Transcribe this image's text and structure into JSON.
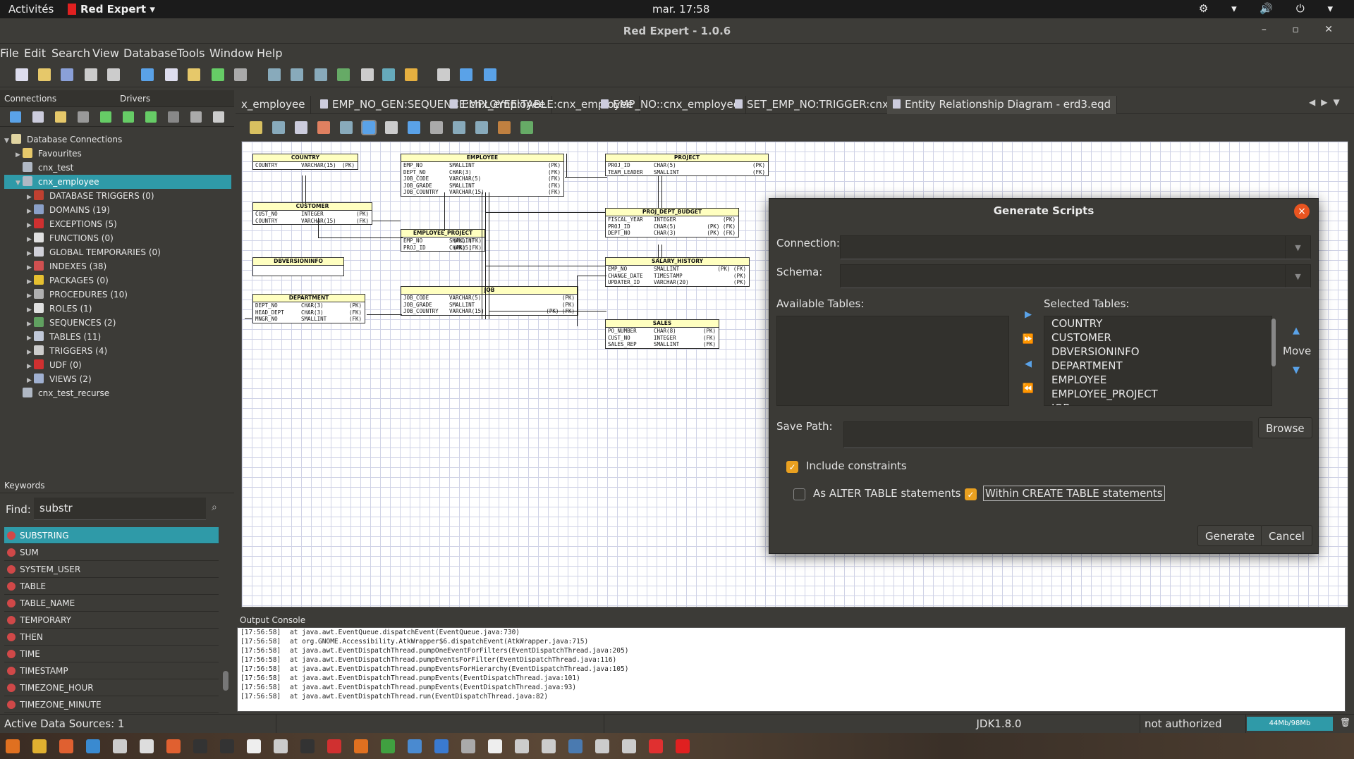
{
  "topbar": {
    "activities": "Activités",
    "app": "Red Expert",
    "clock": "mar. 17:58",
    "tray": "⚙ ▾ 🔊 ⏻ ▾"
  },
  "window": {
    "title": "Red Expert - 1.0.6",
    "controls": "–  ▫  ✕"
  },
  "menu": [
    "File",
    "Edit",
    "Search",
    "View",
    "Database",
    "Tools",
    "Window",
    "Help"
  ],
  "left": {
    "tab_connections": "Connections",
    "tab_drivers": "Drivers",
    "tree": [
      {
        "label": "Database Connections",
        "level": 0,
        "arrow": "▼",
        "color": "#e0d4a0"
      },
      {
        "label": "Favourites",
        "level": 1,
        "arrow": "▶",
        "color": "#e6c86a"
      },
      {
        "label": "cnx_test",
        "level": 1,
        "arrow": "",
        "color": "#b0b8c4"
      },
      {
        "label": "cnx_employee",
        "level": 1,
        "arrow": "▼",
        "color": "#b0b8c4",
        "selected": true
      },
      {
        "label": "DATABASE TRIGGERS (0)",
        "level": 2,
        "arrow": "▶",
        "color": "#c04030"
      },
      {
        "label": "DOMAINS (19)",
        "level": 2,
        "arrow": "▶",
        "color": "#8aa0c8"
      },
      {
        "label": "EXCEPTIONS (5)",
        "level": 2,
        "arrow": "▶",
        "color": "#d03030"
      },
      {
        "label": "FUNCTIONS (0)",
        "level": 2,
        "arrow": "▶",
        "color": "#e0e0e0"
      },
      {
        "label": "GLOBAL TEMPORARIES (0)",
        "level": 2,
        "arrow": "▶",
        "color": "#d0d0d8"
      },
      {
        "label": "INDEXES (38)",
        "level": 2,
        "arrow": "▶",
        "color": "#d05050"
      },
      {
        "label": "PACKAGES (0)",
        "level": 2,
        "arrow": "▶",
        "color": "#e6c030"
      },
      {
        "label": "PROCEDURES (10)",
        "level": 2,
        "arrow": "▶",
        "color": "#b0b0b0"
      },
      {
        "label": "ROLES (1)",
        "level": 2,
        "arrow": "▶",
        "color": "#e0e0e0"
      },
      {
        "label": "SEQUENCES (2)",
        "level": 2,
        "arrow": "▶",
        "color": "#60a060"
      },
      {
        "label": "TABLES (11)",
        "level": 2,
        "arrow": "▶",
        "color": "#c0c8d8"
      },
      {
        "label": "TRIGGERS (4)",
        "level": 2,
        "arrow": "▶",
        "color": "#cccccc"
      },
      {
        "label": "UDF (0)",
        "level": 2,
        "arrow": "▶",
        "color": "#d03030"
      },
      {
        "label": "VIEWS (2)",
        "level": 2,
        "arrow": "▶",
        "color": "#a0b0d0"
      },
      {
        "label": "cnx_test_recurse",
        "level": 1,
        "arrow": "",
        "color": "#b0b8c4"
      }
    ]
  },
  "keywords": {
    "title": "Keywords",
    "find_label": "Find:",
    "find_value": "substr",
    "items": [
      "SUBSTRING",
      "SUM",
      "SYSTEM_USER",
      "TABLE",
      "TABLE_NAME",
      "TEMPORARY",
      "THEN",
      "TIME",
      "TIMESTAMP",
      "TIMEZONE_HOUR",
      "TIMEZONE_MINUTE"
    ]
  },
  "tabs": [
    "x_employee",
    "EMP_NO_GEN:SEQUENCE:cnx_employee",
    "EMPLOYEE:TABLE:cnx_employee",
    "EMP_NO::cnx_employee",
    "SET_EMP_NO:TRIGGER:cnx_employee",
    "Entity Relationship Diagram - erd3.eqd"
  ],
  "erd": {
    "entities": [
      {
        "name": "COUNTRY",
        "rows": [
          [
            "COUNTRY",
            "VARCHAR(15)",
            "(PK)"
          ]
        ]
      },
      {
        "name": "EMPLOYEE",
        "rows": [
          [
            "EMP_NO",
            "SMALLINT",
            "(PK)"
          ],
          [
            "DEPT_NO",
            "CHAR(3)",
            "(FK)"
          ],
          [
            "JOB_CODE",
            "VARCHAR(5)",
            "(FK)"
          ],
          [
            "JOB_GRADE",
            "SMALLINT",
            "(FK)"
          ],
          [
            "JOB_COUNTRY",
            "VARCHAR(15)",
            "(FK)"
          ]
        ]
      },
      {
        "name": "PROJECT",
        "rows": [
          [
            "PROJ_ID",
            "CHAR(5)",
            "(PK)"
          ],
          [
            "TEAM_LEADER",
            "SMALLINT",
            "(FK)"
          ]
        ]
      },
      {
        "name": "CUSTOMER",
        "rows": [
          [
            "CUST_NO",
            "INTEGER",
            "(PK)"
          ],
          [
            "COUNTRY",
            "VARCHAR(15)",
            "(FK)"
          ]
        ]
      },
      {
        "name": "EMPLOYEE_PROJECT",
        "rows": [
          [
            "EMP_NO",
            "SMALLINT",
            "(PK) (FK)"
          ],
          [
            "PROJ_ID",
            "CHAR(5)",
            "(PK) (FK)"
          ]
        ]
      },
      {
        "name": "PROJ_DEPT_BUDGET",
        "rows": [
          [
            "FISCAL_YEAR",
            "INTEGER",
            "(PK)"
          ],
          [
            "PROJ_ID",
            "CHAR(5)",
            "(PK) (FK)"
          ],
          [
            "DEPT_NO",
            "CHAR(3)",
            "(PK) (FK)"
          ]
        ]
      },
      {
        "name": "DBVERSIONINFO",
        "rows": []
      },
      {
        "name": "SALARY_HISTORY",
        "rows": [
          [
            "EMP_NO",
            "SMALLINT",
            "(PK) (FK)"
          ],
          [
            "CHANGE_DATE",
            "TIMESTAMP",
            "(PK)"
          ],
          [
            "UPDATER_ID",
            "VARCHAR(20)",
            "(PK)"
          ]
        ]
      },
      {
        "name": "JOB",
        "rows": [
          [
            "JOB_CODE",
            "VARCHAR(5)",
            "(PK)"
          ],
          [
            "JOB_GRADE",
            "SMALLINT",
            "(PK)"
          ],
          [
            "JOB_COUNTRY",
            "VARCHAR(15)",
            "(PK) (FK)"
          ]
        ]
      },
      {
        "name": "DEPARTMENT",
        "rows": [
          [
            "DEPT_NO",
            "CHAR(3)",
            "(PK)"
          ],
          [
            "HEAD_DEPT",
            "CHAR(3)",
            "(FK)"
          ],
          [
            "MNGR_NO",
            "SMALLINT",
            "(FK)"
          ]
        ]
      },
      {
        "name": "SALES",
        "rows": [
          [
            "PO_NUMBER",
            "CHAR(8)",
            "(PK)"
          ],
          [
            "CUST_NO",
            "INTEGER",
            "(FK)"
          ],
          [
            "SALES_REP",
            "SMALLINT",
            "(FK)"
          ]
        ]
      }
    ]
  },
  "dialog": {
    "title": "Generate Scripts",
    "close": "×",
    "connection_label": "Connection:",
    "schema_label": "Schema:",
    "available_label": "Available Tables:",
    "selected_label": "Selected Tables:",
    "selected_tables": [
      "COUNTRY",
      "CUSTOMER",
      "DBVERSIONINFO",
      "DEPARTMENT",
      "EMPLOYEE",
      "EMPLOYEE_PROJECT",
      "JOB"
    ],
    "move_label": "Move",
    "save_path_label": "Save Path:",
    "browse": "Browse",
    "include_constraints": "Include constraints",
    "include_constraints_checked": true,
    "as_alter": "As ALTER TABLE statements",
    "as_alter_checked": false,
    "within_create": "Within CREATE TABLE statements",
    "within_create_checked": true,
    "generate": "Generate",
    "cancel": "Cancel"
  },
  "output": {
    "title": "Output Console",
    "lines": [
      [
        "[17:56:58]",
        "at java.awt.EventQueue.dispatchEvent(EventQueue.java:730)"
      ],
      [
        "[17:56:58]",
        "at org.GNOME.Accessibility.AtkWrapper$6.dispatchEvent(AtkWrapper.java:715)"
      ],
      [
        "[17:56:58]",
        "at java.awt.EventDispatchThread.pumpOneEventForFilters(EventDispatchThread.java:205)"
      ],
      [
        "[17:56:58]",
        "at java.awt.EventDispatchThread.pumpEventsForFilter(EventDispatchThread.java:116)"
      ],
      [
        "[17:56:58]",
        "at java.awt.EventDispatchThread.pumpEventsForHierarchy(EventDispatchThread.java:105)"
      ],
      [
        "[17:56:58]",
        "at java.awt.EventDispatchThread.pumpEvents(EventDispatchThread.java:101)"
      ],
      [
        "[17:56:58]",
        "at java.awt.EventDispatchThread.pumpEvents(EventDispatchThread.java:93)"
      ],
      [
        "[17:56:58]",
        "at java.awt.EventDispatchThread.run(EventDispatchThread.java:82)"
      ]
    ]
  },
  "status": {
    "active": "Active Data Sources: 1",
    "jdk": "JDK1.8.0",
    "auth": "not authorized",
    "memory": "44Mb/98Mb"
  }
}
